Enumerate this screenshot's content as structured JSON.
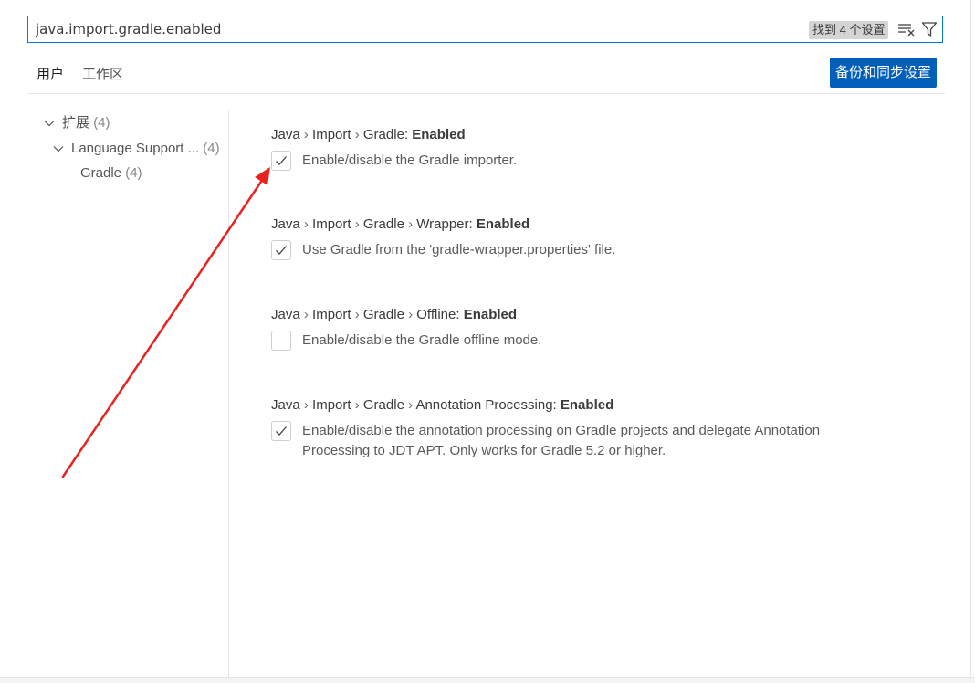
{
  "search": {
    "value": "java.import.gradle.enabled",
    "result_count": "找到 4 个设置",
    "icons": [
      "clear-filter-icon",
      "filter-icon"
    ]
  },
  "tabs": [
    {
      "label": "用户",
      "active": true
    },
    {
      "label": "工作区",
      "active": false
    }
  ],
  "sync_button_label": "备份和同步设置",
  "toc": {
    "root": {
      "label": "扩展",
      "count": "(4)"
    },
    "child": {
      "label": "Language Support ...",
      "count": "(4)"
    },
    "leaf": {
      "label": "Gradle",
      "count": "(4)"
    }
  },
  "settings": [
    {
      "path": [
        "Java",
        "Import",
        "Gradle"
      ],
      "key": "Enabled",
      "description": "Enable/disable the Gradle importer.",
      "checked": true
    },
    {
      "path": [
        "Java",
        "Import",
        "Gradle",
        "Wrapper"
      ],
      "key": "Enabled",
      "description": "Use Gradle from the 'gradle-wrapper.properties' file.",
      "checked": true
    },
    {
      "path": [
        "Java",
        "Import",
        "Gradle",
        "Offline"
      ],
      "key": "Enabled",
      "description": "Enable/disable the Gradle offline mode.",
      "checked": false
    },
    {
      "path": [
        "Java",
        "Import",
        "Gradle",
        "Annotation Processing"
      ],
      "key": "Enabled",
      "description": "Enable/disable the annotation processing on Gradle projects and delegate Annotation Processing to JDT APT. Only works for Gradle 5.2 or higher.",
      "checked": true
    }
  ],
  "colors": {
    "accent": "#005fb8",
    "focus_border": "#0078d4",
    "annotation_arrow": "#e8231f"
  }
}
